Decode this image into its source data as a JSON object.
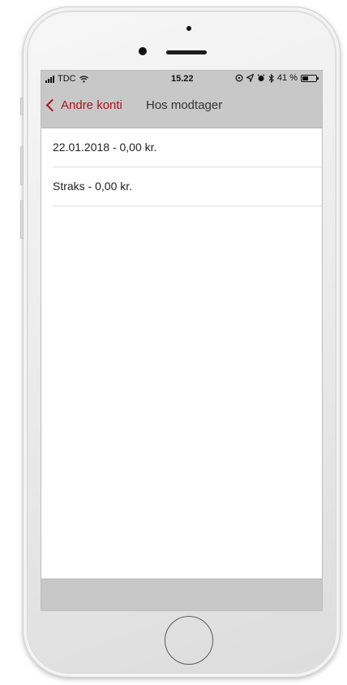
{
  "status_bar": {
    "carrier": "TDC",
    "time": "15.22",
    "battery_percent": "41 %",
    "battery_level": 0.41,
    "icons": [
      "signal-icon",
      "wifi-icon",
      "location-icon",
      "alarm-icon",
      "bluetooth-icon",
      "battery-icon"
    ]
  },
  "nav": {
    "back_label": "Andre konti",
    "title": "Hos modtager",
    "accent_color": "#a8151c"
  },
  "list": {
    "items": [
      {
        "label": "22.01.2018 - 0,00 kr."
      },
      {
        "label": "Straks - 0,00 kr."
      }
    ]
  }
}
